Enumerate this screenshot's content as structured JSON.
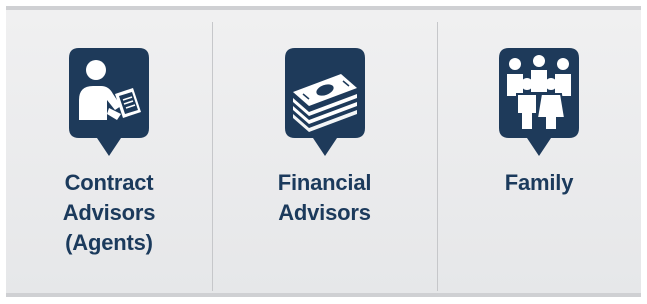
{
  "colors": {
    "pin_fill": "#1e3a5a",
    "icon_fill": "#ffffff",
    "label_text": "#1b3a5c",
    "panel_bg": "#ececee"
  },
  "items": [
    {
      "icon": "advisor-signing-icon",
      "label_lines": [
        "Contract",
        "Advisors",
        "(Agents)"
      ]
    },
    {
      "icon": "money-stack-icon",
      "label_lines": [
        "Financial",
        "Advisors"
      ]
    },
    {
      "icon": "family-group-icon",
      "label_lines": [
        "Family"
      ]
    }
  ]
}
